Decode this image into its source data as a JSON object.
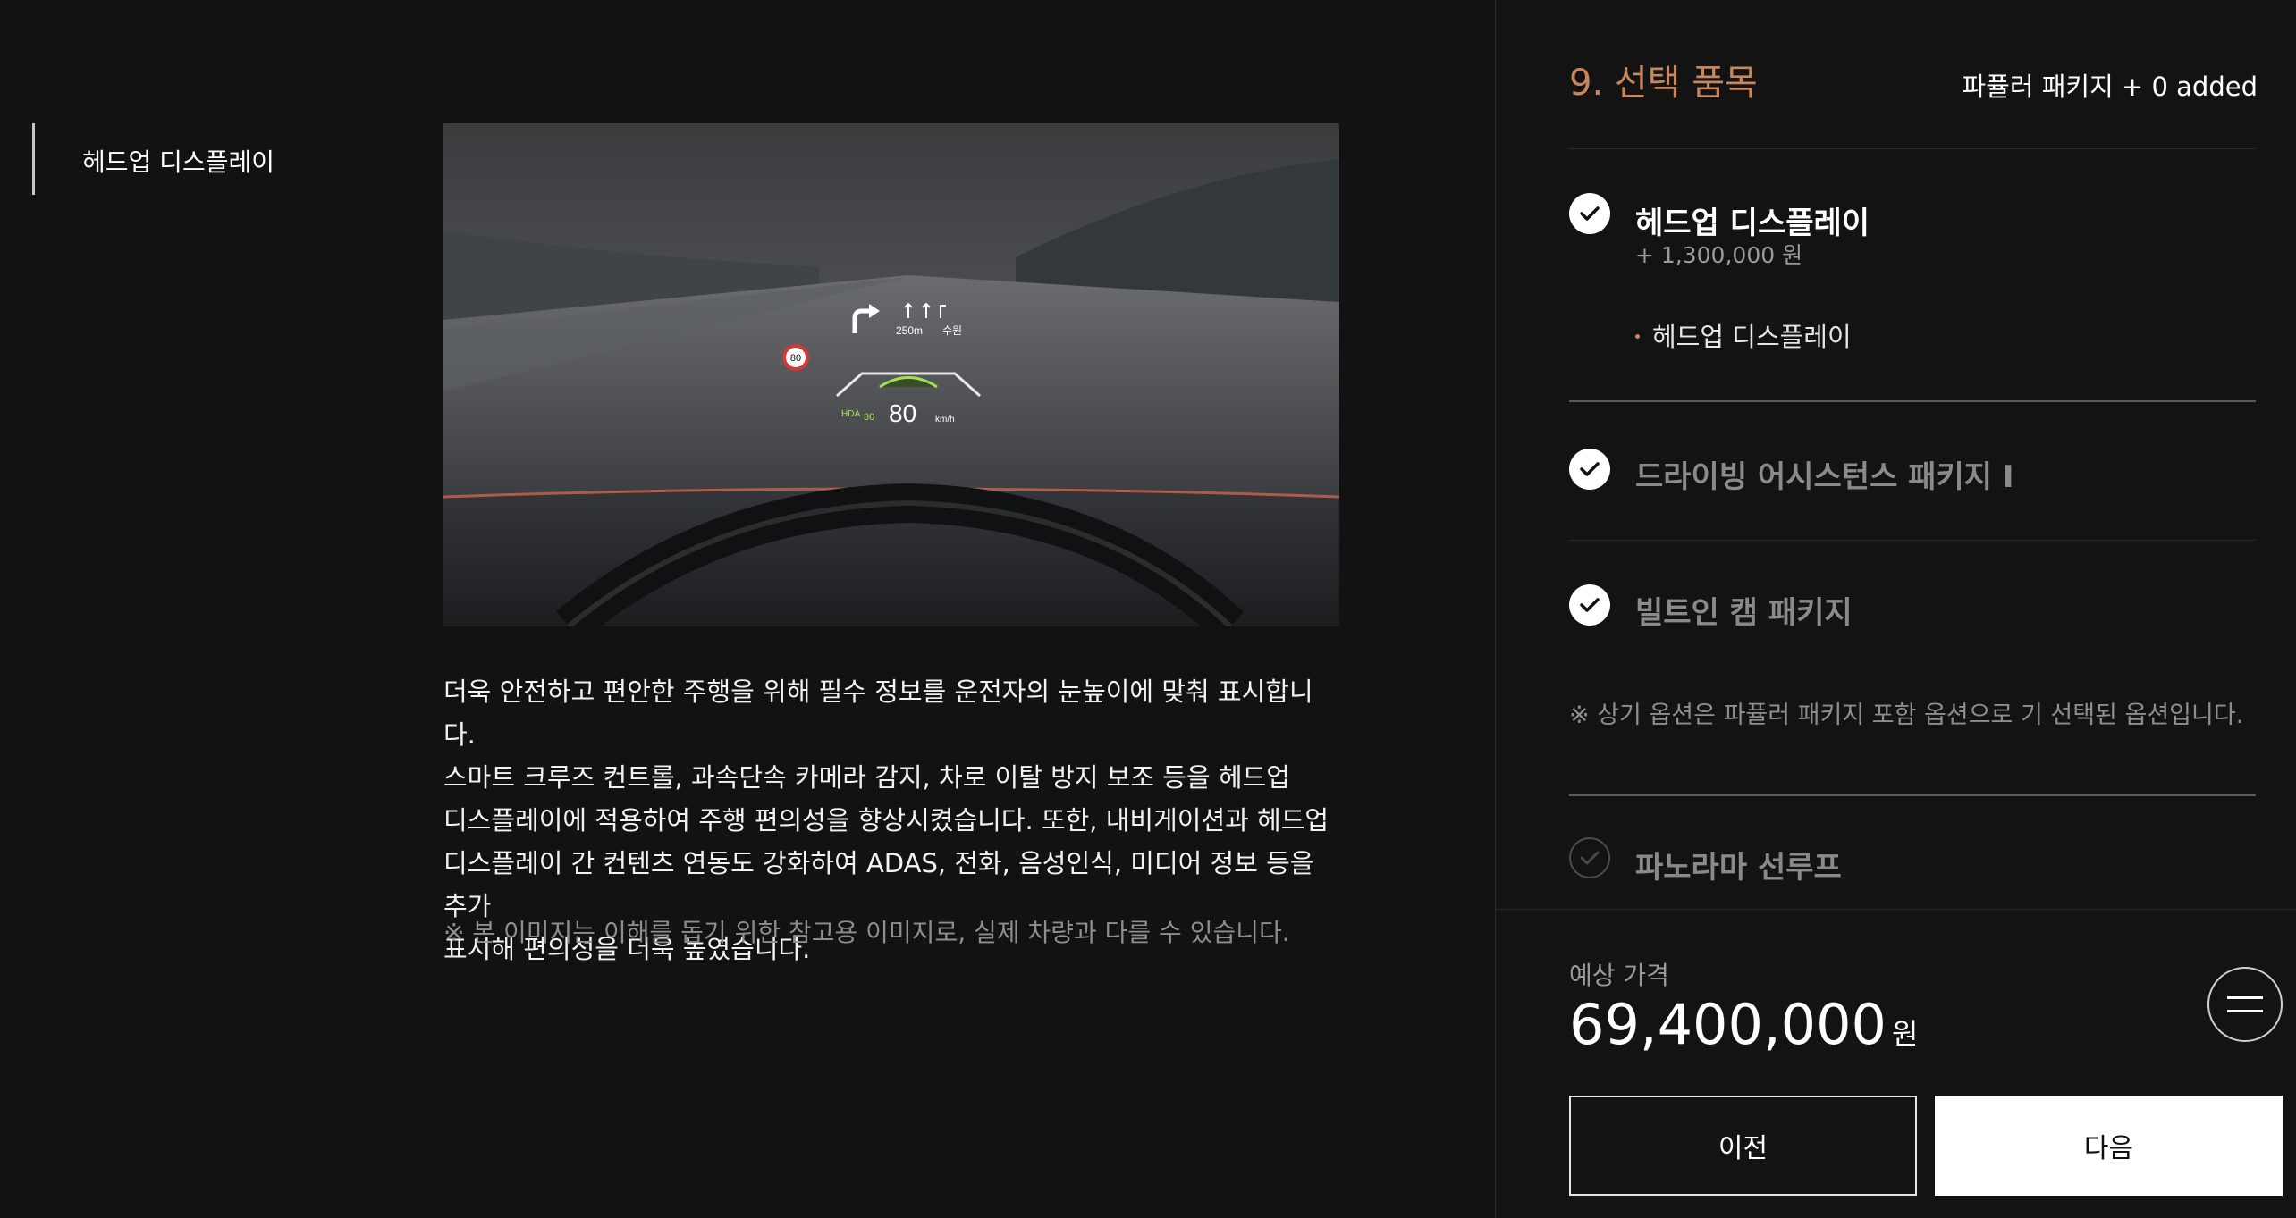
{
  "left_nav": {
    "items": [
      {
        "label": "헤드업 디스플레이"
      }
    ]
  },
  "main": {
    "image": {
      "hud": {
        "distance": "250m",
        "destination": "수원",
        "speed_limit": "80",
        "speed": "80",
        "speed_unit": "km/h",
        "hda_label": "HDA",
        "hda_speed": "80"
      }
    },
    "description_lines": [
      "더욱 안전하고 편안한 주행을 위해 필수 정보를 운전자의 눈높이에 맞춰 표시합니다.",
      "스마트 크루즈 컨트롤, 과속단속 카메라 감지, 차로 이탈 방지 보조 등을 헤드업",
      "디스플레이에 적용하여 주행 편의성을 향상시켰습니다. 또한, 내비게이션과 헤드업",
      "디스플레이 간 컨텐츠 연동도 강화하여 ADAS, 전화, 음성인식, 미디어 정보 등을 추가",
      "표시해 편의성을 더욱 높였습니다."
    ],
    "note": "※ 본 이미지는 이해를 돕기 위한 참고용 이미지로, 실제 차량과 다를 수 있습니다."
  },
  "panel": {
    "step_title": "9. 선택 품목",
    "summary": "파퓰러 패키지 + 0 added",
    "options": [
      {
        "title": "헤드업 디스플레이",
        "price": "+ 1,300,000 원",
        "sub_items": [
          "헤드업 디스플레이"
        ]
      },
      {
        "title": "드라이빙 어시스턴스 패키지 I"
      },
      {
        "title": "빌트인 캠 패키지"
      },
      {
        "title": "파노라마 선루프"
      }
    ],
    "info_note": "※ 상기 옵션은 파퓰러 패키지 포함 옵션으로 기 선택된 옵션입니다.",
    "price_label": "예상 가격",
    "price_value": "69,400,000",
    "price_unit": "원",
    "prev_label": "이전",
    "next_label": "다음"
  },
  "colors": {
    "accent": "#c9865c",
    "background": "#121212",
    "hud_green": "#a6e04a"
  },
  "icons": [
    "check-icon",
    "menu-icon",
    "turn-right-arrow-icon"
  ]
}
